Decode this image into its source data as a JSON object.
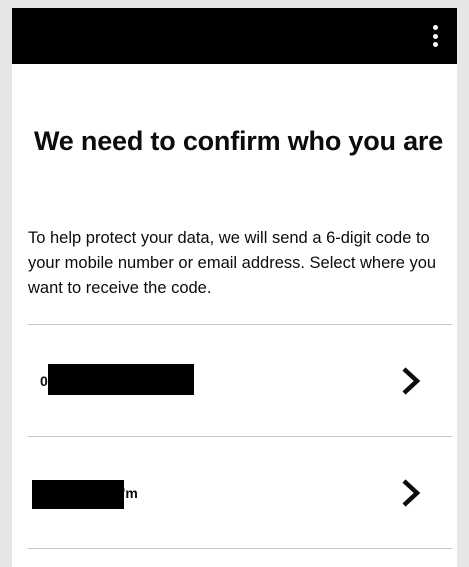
{
  "header": {
    "menu_icon": "more-vertical-icon"
  },
  "page": {
    "title": "We need to confirm who you are",
    "intro": "To help protect your data, we will send a 6-digit code to your mobile number or email address. Select where you want to receive the code."
  },
  "options": [
    {
      "visible_text": "0",
      "icon": "chevron-right-icon"
    },
    {
      "visible_text": "'m",
      "icon": "chevron-right-icon"
    }
  ],
  "colors": {
    "header_bg": "#000000",
    "page_bg": "#e6e6e6",
    "card_bg": "#ffffff",
    "text": "#0b0c0c",
    "divider": "#c8c8c8"
  }
}
